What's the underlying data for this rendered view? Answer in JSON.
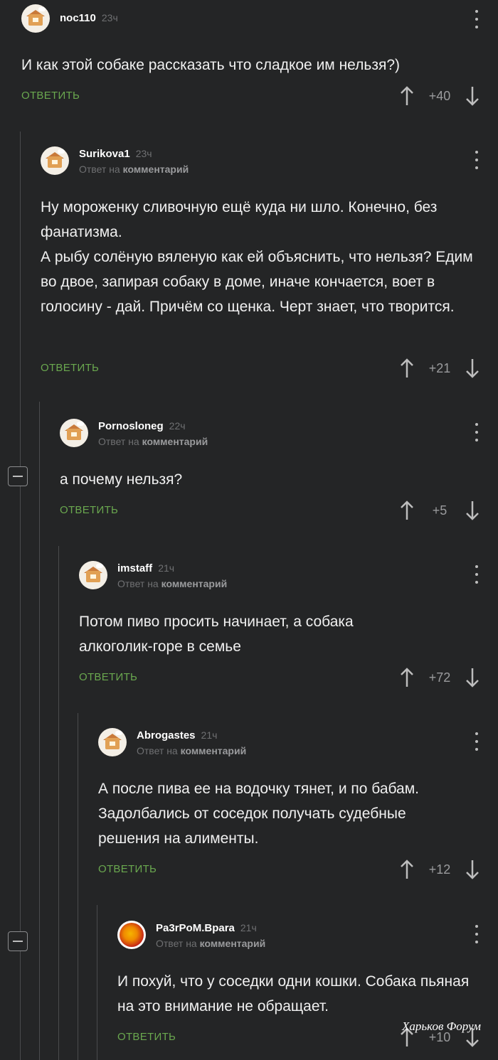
{
  "comments": [
    {
      "username": "noc110",
      "time": "23ч",
      "reply_label": "",
      "reply_link": "",
      "text": "И как этой собаке рассказать что сладкое им нельзя?)",
      "reply_button": "ОТВЕТИТЬ",
      "score": "+40"
    },
    {
      "username": "Surikova1",
      "time": "23ч",
      "reply_label": "Ответ на",
      "reply_link": "комментарий",
      "text": "Ну мороженку сливочную ещё куда ни шло. Конечно, без фанатизма.\nА рыбу солёную вяленую как ей объяснить, что нельзя? Едим во двое, запирая собаку в доме, иначе кончается, воет в голосину - дай. Причём со щенка. Черт знает, что творится.",
      "reply_button": "ОТВЕТИТЬ",
      "score": "+21"
    },
    {
      "username": "Pornosloneg",
      "time": "22ч",
      "reply_label": "Ответ на",
      "reply_link": "комментарий",
      "text": "а почему нельзя?",
      "reply_button": "ОТВЕТИТЬ",
      "score": "+5"
    },
    {
      "username": "imstaff",
      "time": "21ч",
      "reply_label": "Ответ на",
      "reply_link": "комментарий",
      "text": "Потом пиво просить начинает, а собака алкоголик-горе в семье",
      "reply_button": "ОТВЕТИТЬ",
      "score": "+72"
    },
    {
      "username": "Abrogastes",
      "time": "21ч",
      "reply_label": "Ответ на",
      "reply_link": "комментарий",
      "text": "А после пива ее на водочку тянет, и по бабам. Задолбались от соседок получать судебные решения на алименты.",
      "reply_button": "ОТВЕТИТЬ",
      "score": "+12"
    },
    {
      "username": "Pa3rPoM.Bpara",
      "time": "21ч",
      "reply_label": "Ответ на",
      "reply_link": "комментарий",
      "text": "И похуй, что у соседки одни кошки. Собака пьяная на это внимание не обращает.",
      "reply_button": "ОТВЕТИТЬ",
      "score": "+10"
    }
  ],
  "watermark": "Харьков Форум",
  "colors": {
    "background": "#242526",
    "reply_button": "#6aa84f",
    "muted": "#6f7072",
    "thread_line": "#4a4b4d"
  },
  "icons": [
    "avatar-house",
    "avatar-emblem",
    "kebab-menu-icon",
    "arrow-up-icon",
    "arrow-down-icon",
    "collapse-minus-icon"
  ]
}
